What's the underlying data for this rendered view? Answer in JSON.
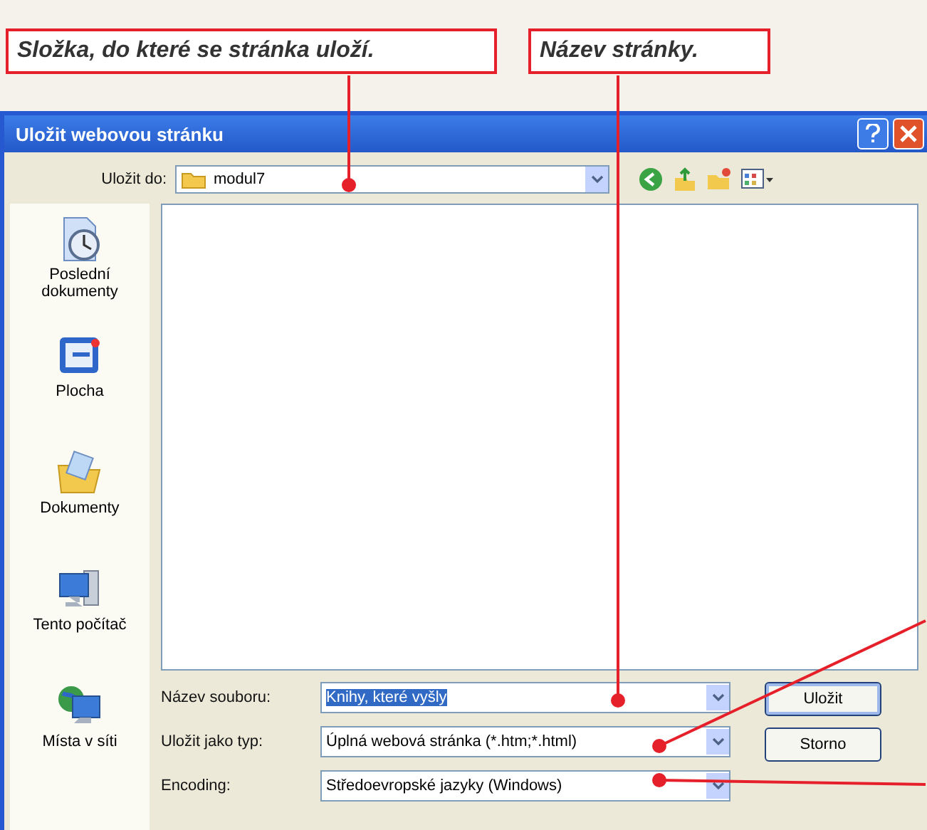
{
  "callouts": [
    {
      "text": "Složka, do které se stránka uloží."
    },
    {
      "text": "Název stránky."
    }
  ],
  "window": {
    "title": "Uložit webovou stránku"
  },
  "save_in": {
    "label": "Uložit do:",
    "value": "modul7"
  },
  "places": [
    {
      "label": "Poslední dokumenty",
      "kind": "recent"
    },
    {
      "label": "Plocha",
      "kind": "desktop"
    },
    {
      "label": "Dokumenty",
      "kind": "documents"
    },
    {
      "label": "Tento počítač",
      "kind": "computer"
    },
    {
      "label": "Místa v síti",
      "kind": "network"
    }
  ],
  "fields": [
    {
      "label": "Název souboru:",
      "value": "Knihy, které vyšly",
      "selected": true
    },
    {
      "label": "Uložit jako typ:",
      "value": "Úplná webová stránka (*.htm;*.html)",
      "selected": false
    },
    {
      "label": "Encoding:",
      "value": "Středoevropské jazyky (Windows)",
      "selected": false
    }
  ],
  "buttons": [
    "Uložit",
    "Storno"
  ]
}
